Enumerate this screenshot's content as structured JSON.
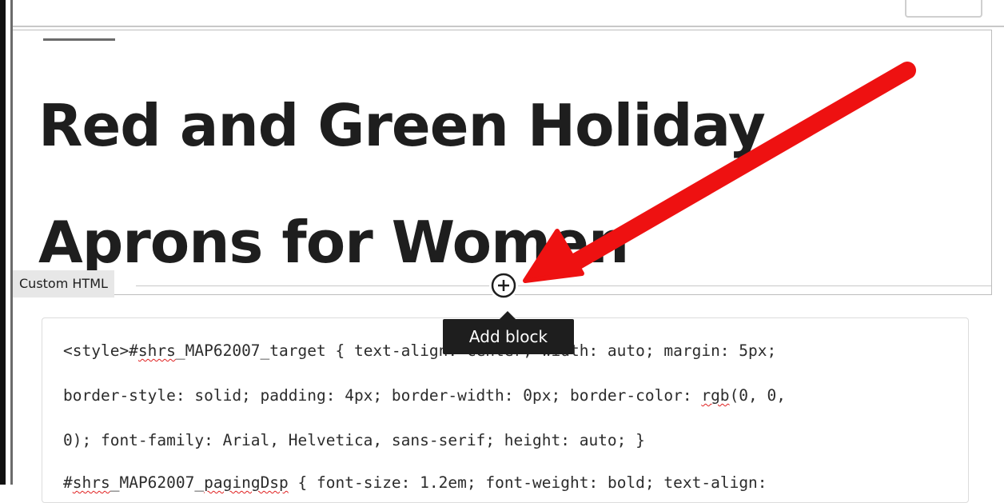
{
  "title_block": {
    "heading_line1": "Red and Green Holiday",
    "heading_line2": "Aprons for Women"
  },
  "block_label": "Custom HTML",
  "add_block": {
    "tooltip": "Add block",
    "icon": "plus-circle-icon"
  },
  "code_lines": [
    [
      "<style>#",
      "shrs",
      "_MAP62007_target { text-align: center; width: auto; margin: 5px;"
    ],
    [
      "border-style: solid; padding: 4px; border-width: 0px; border-color: ",
      "rgb",
      "(0, 0,"
    ],
    [
      "0); font-family: Arial, Helvetica, sans-serif; height: auto; }"
    ],
    [
      "#",
      "shrs",
      "_MAP62007_",
      "pagingDsp",
      " { font-size: 1.2em; font-weight: bold; text-align:"
    ]
  ],
  "colors": {
    "annotation_arrow": "#ee1111",
    "tooltip_bg": "#1e1e1e",
    "spellcheck_underline": "#e02020"
  }
}
